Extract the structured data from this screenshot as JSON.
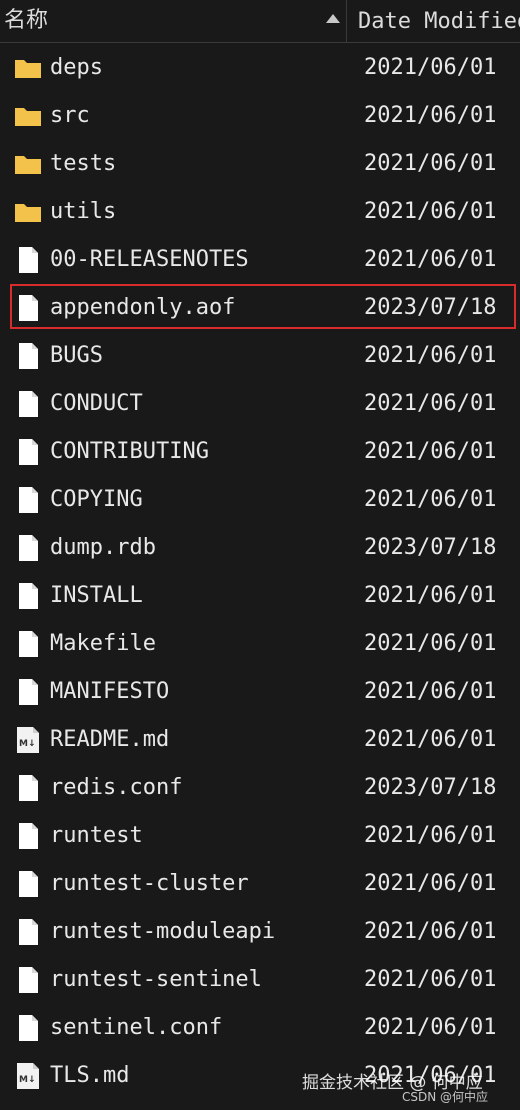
{
  "header": {
    "name_label": "名称",
    "date_label": "Date Modified"
  },
  "files": [
    {
      "name": "deps",
      "date": "2021/06/01",
      "icon": "folder-icon"
    },
    {
      "name": "src",
      "date": "2021/06/01",
      "icon": "folder-icon"
    },
    {
      "name": "tests",
      "date": "2021/06/01",
      "icon": "folder-icon"
    },
    {
      "name": "utils",
      "date": "2021/06/01",
      "icon": "folder-icon"
    },
    {
      "name": "00-RELEASENOTES",
      "date": "2021/06/01",
      "icon": "file-icon"
    },
    {
      "name": "appendonly.aof",
      "date": "2023/07/18",
      "icon": "file-icon",
      "highlighted": true
    },
    {
      "name": "BUGS",
      "date": "2021/06/01",
      "icon": "file-icon"
    },
    {
      "name": "CONDUCT",
      "date": "2021/06/01",
      "icon": "file-icon"
    },
    {
      "name": "CONTRIBUTING",
      "date": "2021/06/01",
      "icon": "file-icon"
    },
    {
      "name": "COPYING",
      "date": "2021/06/01",
      "icon": "file-icon"
    },
    {
      "name": "dump.rdb",
      "date": "2023/07/18",
      "icon": "file-icon"
    },
    {
      "name": "INSTALL",
      "date": "2021/06/01",
      "icon": "file-icon"
    },
    {
      "name": "Makefile",
      "date": "2021/06/01",
      "icon": "file-icon"
    },
    {
      "name": "MANIFESTO",
      "date": "2021/06/01",
      "icon": "file-icon"
    },
    {
      "name": "README.md",
      "date": "2021/06/01",
      "icon": "markdown-file-icon"
    },
    {
      "name": "redis.conf",
      "date": "2023/07/18",
      "icon": "file-icon"
    },
    {
      "name": "runtest",
      "date": "2021/06/01",
      "icon": "file-icon"
    },
    {
      "name": "runtest-cluster",
      "date": "2021/06/01",
      "icon": "file-icon"
    },
    {
      "name": "runtest-moduleapi",
      "date": "2021/06/01",
      "icon": "file-icon"
    },
    {
      "name": "runtest-sentinel",
      "date": "2021/06/01",
      "icon": "file-icon"
    },
    {
      "name": "sentinel.conf",
      "date": "2021/06/01",
      "icon": "file-icon"
    },
    {
      "name": "TLS.md",
      "date": "2021/06/01",
      "icon": "markdown-file-icon"
    }
  ],
  "colors": {
    "background": "#191919",
    "text": "#e8e8e8",
    "folder": "#f3c24a",
    "highlight_border": "#d82b2b"
  },
  "watermark": {
    "main": "掘金技术社区 @ 何中应",
    "sub": "CSDN @何中应"
  }
}
